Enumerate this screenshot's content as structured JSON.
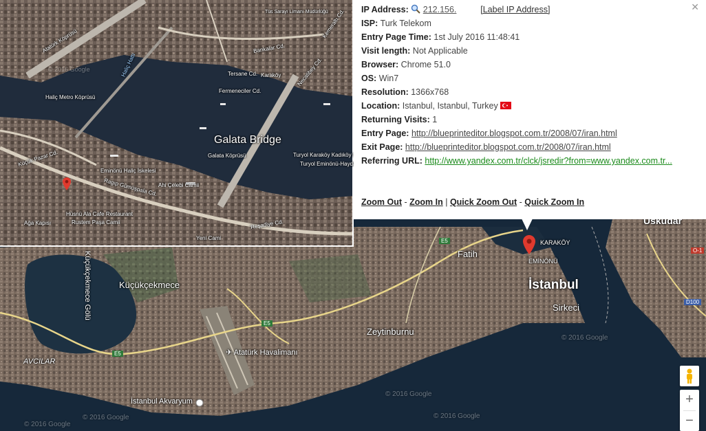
{
  "info": {
    "ip_label": "IP Address:",
    "ip_value": "212.156.",
    "label_ip_link": "[Label IP Address]",
    "isp_label": "ISP:",
    "isp_value": "Turk Telekom",
    "entry_time_label": "Entry Page Time:",
    "entry_time_value": "1st July 2016 11:48:41",
    "visit_length_label": "Visit length:",
    "visit_length_value": "Not Applicable",
    "browser_label": "Browser:",
    "browser_value": "Chrome 51.0",
    "os_label": "OS:",
    "os_value": "Win7",
    "resolution_label": "Resolution:",
    "resolution_value": "1366x768",
    "location_label": "Location:",
    "location_value": "Istanbul, Istanbul, Turkey",
    "returning_label": "Returning Visits:",
    "returning_value": "1",
    "entry_page_label": "Entry Page:",
    "entry_page_value": "http://blueprinteditor.blogspot.com.tr/2008/07/iran.html",
    "exit_page_label": "Exit Page:",
    "exit_page_value": "http://blueprinteditor.blogspot.com.tr/2008/07/iran.html",
    "referring_label": "Referring URL:",
    "referring_value": "http://www.yandex.com.tr/clck/jsredir?from=www.yandex.com.tr...",
    "close_symbol": "✕",
    "zoom_out": "Zoom Out",
    "zoom_in": "Zoom In",
    "quick_zoom_out": "Quick Zoom Out",
    "quick_zoom_in": "Quick Zoom In",
    "sep_dash": " - ",
    "sep_pipe": " | "
  },
  "inset_map": {
    "title": "Galata Bridge",
    "labels": {
      "ataturk_koprusu": "Atatürk Köprüsü",
      "halic_metro": "Haliç Metro Köprüsü",
      "tersane": "Tersane Cd.",
      "fermeneciler": "Fermeneciler Cd.",
      "galata_koprusu": "Galata Köprüsü",
      "eminonu_iskelesi": "Eminönü Haliç İskelesi",
      "ragip": "Ragıp Gümüşpala Cd.",
      "karakoy_kadikoy": "Turyol Karaköy Kadıköy Hattı",
      "eminonu_haydarpasa": "Turyol Eminönü-Haydarpaşa",
      "resadiye": "Reşadiye Cd.",
      "husnu": "Hüsnü Ala Cafe Restaurant",
      "rustem": "Rustem Paşa Camii",
      "aga_kapisi": "Ağa Kapısı",
      "kucuk_pazar": "Küçük Pazar Cd.",
      "ahi_celebi": "Ahi Çelebi Camii",
      "yeni_cami": "Yeni Cami",
      "halic_hatti": "Haliç Hattı",
      "karakoy_label": "Karaköy",
      "necatibey": "Necatibey Cd.",
      "kemeralti": "Kemeraltı Cd.",
      "bankalar": "Bankalar Cd.",
      "tis_sarayi": "Tüs Sarayı Limanı Müdürlüğü",
      "copyright": "© 2016 Google"
    }
  },
  "main_map": {
    "labels": {
      "uskudar": "Üsküdar",
      "karakoy": "KARAKÖY",
      "eminonu": "EMİNÖNÜ",
      "istanbul": "İstanbul",
      "sirkeci": "Sirkeci",
      "fatih": "Fatih",
      "zeytinburnu": "Zeytinburnu",
      "kucukcekmece": "Küçükçekmece",
      "kucukcekmece_golu": "Küçükçekmece Gölü",
      "avcilar": "AVCILAR",
      "ataturk_havalimani": "Atatürk Havalimanı",
      "akvaryum": "İstanbul Akvaryum",
      "e5_a": "E5",
      "e5_b": "E5",
      "e5_c": "E5",
      "d100": "D100",
      "o1": "O-1",
      "watermark1": "© 2016 Google",
      "watermark2": "© 2016 Google",
      "watermark3": "© 2016 Google",
      "watermark4": "© 2016 Google",
      "watermark5": "© 2016 Google"
    },
    "zoom_plus": "+",
    "zoom_minus": "−"
  }
}
